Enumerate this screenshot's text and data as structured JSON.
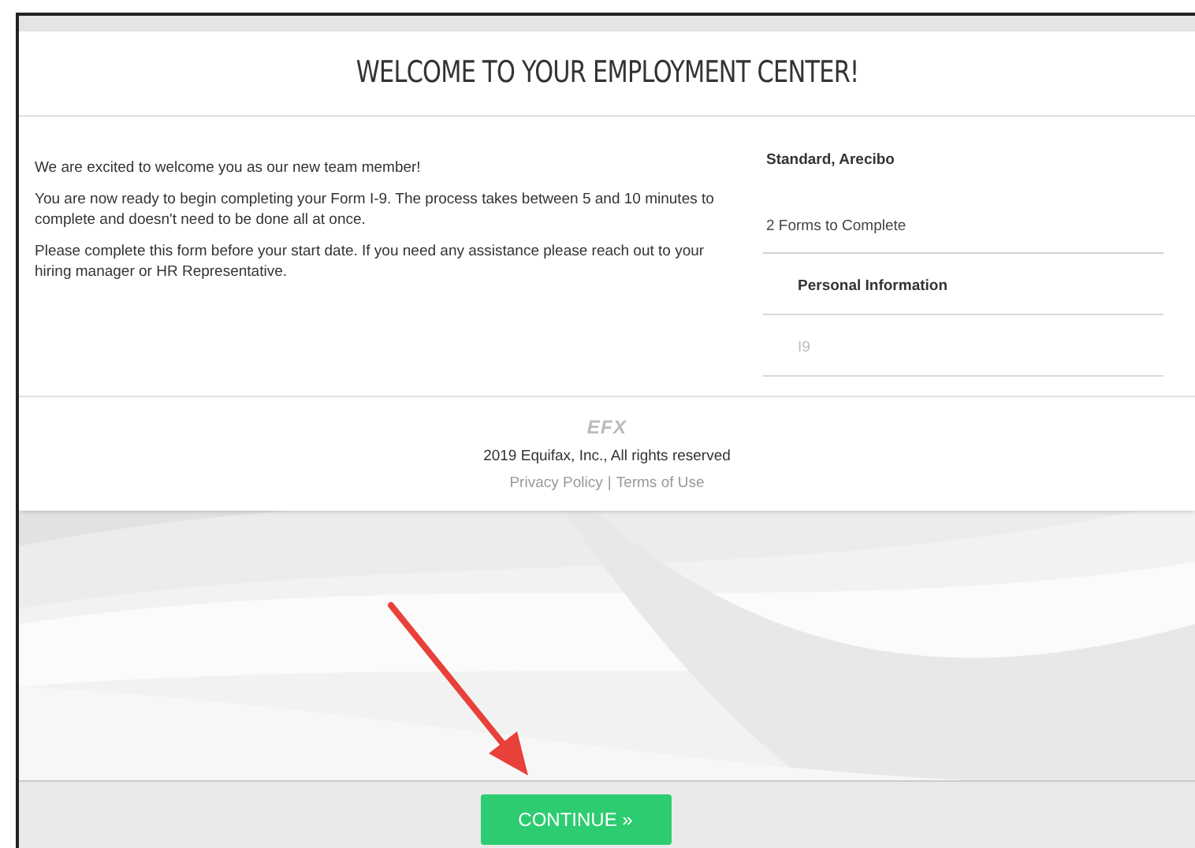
{
  "header": {
    "title": "WELCOME TO YOUR EMPLOYMENT CENTER!"
  },
  "intro": [
    "We are excited to welcome you as our new team member!",
    "You are now ready to begin completing your Form I-9. The process takes between 5 and 10 minutes to complete and doesn't need to be done all at once.",
    "Please complete this form before your start date. If you need any assistance please reach out to your hiring manager or HR Representative."
  ],
  "summary": {
    "name": "Standard, Arecibo",
    "count": "2 Forms to Complete",
    "forms": [
      {
        "label": "Personal Information",
        "kind": "heading"
      },
      {
        "label": "I9",
        "kind": "pending"
      }
    ]
  },
  "footer": {
    "logo": "EFX",
    "copyright": "2019 Equifax, Inc., All rights reserved",
    "links": [
      "Privacy Policy",
      "Terms of Use"
    ],
    "separator": "|"
  },
  "continue_button": {
    "label": "CONTINUE »"
  }
}
